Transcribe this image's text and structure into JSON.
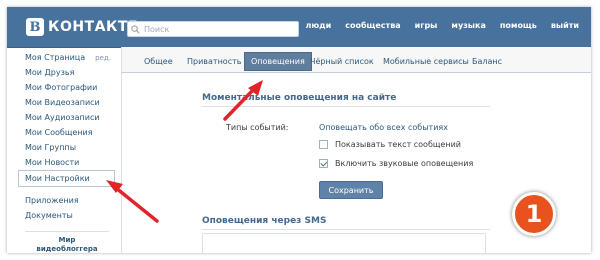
{
  "header": {
    "logo_letter": "В",
    "logo_text": "КОНТАКТЕ",
    "search_placeholder": "Поиск",
    "nav": [
      "люди",
      "сообщества",
      "игры",
      "музыка",
      "помощь",
      "выйти"
    ]
  },
  "sidebar": {
    "items": [
      {
        "label": "Моя Страница",
        "edit": "ред."
      },
      {
        "label": "Мои Друзья"
      },
      {
        "label": "Мои Фотографии"
      },
      {
        "label": "Мои Видеозаписи"
      },
      {
        "label": "Мои Аудиозаписи"
      },
      {
        "label": "Мои Сообщения"
      },
      {
        "label": "Мои Группы"
      },
      {
        "label": "Мои Новости"
      },
      {
        "label": "Мои Настройки"
      }
    ],
    "extra_items": [
      {
        "label": "Приложения"
      },
      {
        "label": "Документы"
      }
    ],
    "promo_line1": "Мир",
    "promo_line2": "видеоблоггера"
  },
  "tabs": [
    "Общее",
    "Приватность",
    "Оповещения",
    "Чёрный список",
    "Мобильные сервисы",
    "Баланс"
  ],
  "active_tab": "Оповещения",
  "instant": {
    "title": "Моментальные оповещения на сайте",
    "events_label": "Типы событий:",
    "events_value": "Оповещать обо всех событиях",
    "show_text_label": "Показывать текст сообщений",
    "show_text_checked": false,
    "sound_label": "Включить звуковые оповещения",
    "sound_checked": true,
    "save_label": "Сохранить"
  },
  "sms": {
    "title": "Оповещения через SMS"
  },
  "badge_number": "1",
  "colors": {
    "header_bg": "#48729e",
    "active_tab_bg": "#5f7e9e",
    "link": "#2b587a",
    "badge": "#e8521e",
    "arrow": "#e0242a"
  }
}
